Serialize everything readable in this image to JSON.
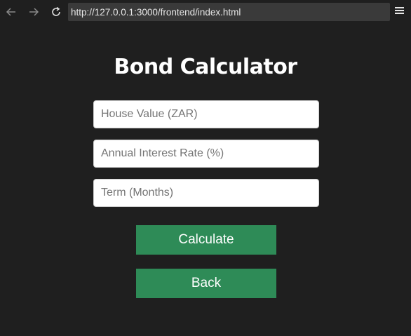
{
  "browser": {
    "url": "http://127.0.0.1:3000/frontend/index.html",
    "icons": [
      "back-arrow-icon",
      "forward-arrow-icon",
      "reload-icon",
      "hamburger-menu-icon"
    ]
  },
  "page": {
    "title": "Bond Calculator",
    "fields": {
      "house_value_placeholder": "House Value (ZAR)",
      "interest_rate_placeholder": "Annual Interest Rate (%)",
      "term_placeholder": "Term (Months)"
    },
    "buttons": {
      "calculate_label": "Calculate",
      "back_label": "Back"
    }
  },
  "colors": {
    "background": "#1f1f1f",
    "button": "#2e8b57",
    "title": "#ffffff"
  }
}
